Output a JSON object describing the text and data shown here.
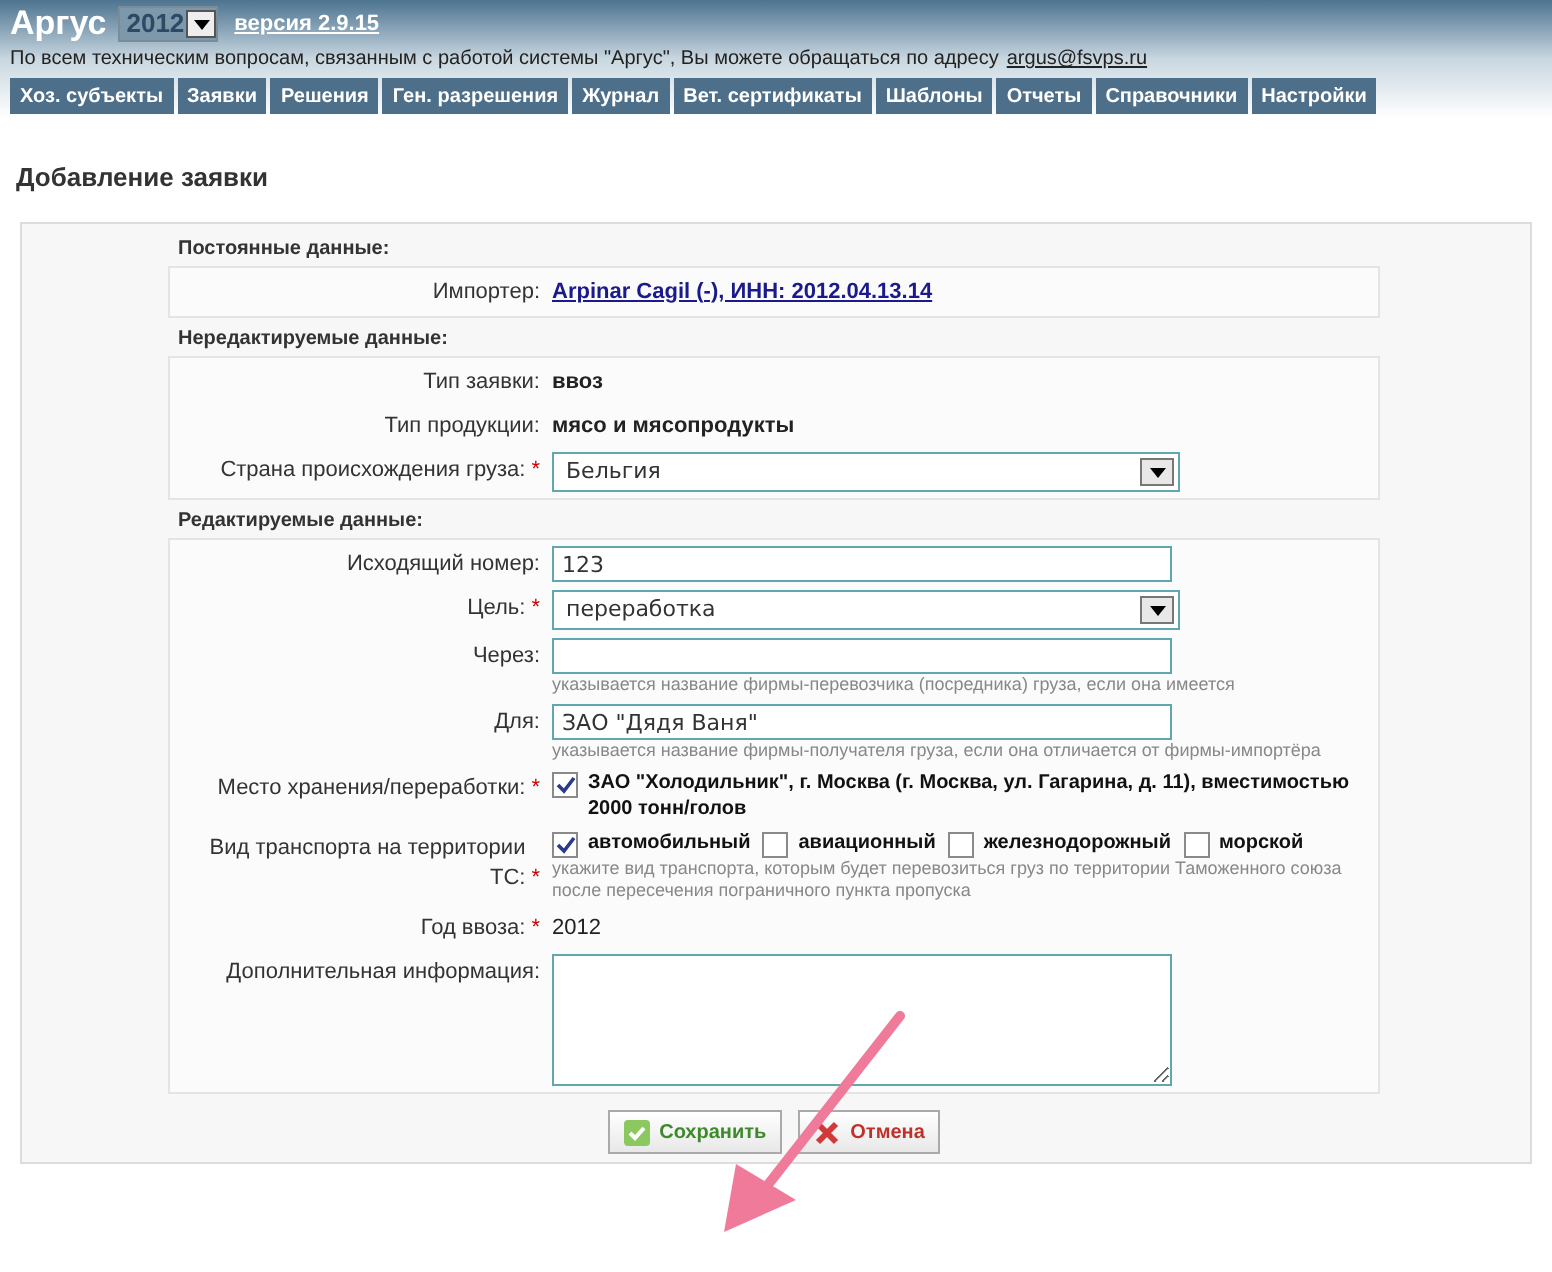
{
  "header": {
    "title": "Аргус",
    "year_select": {
      "value": "2012"
    },
    "version_link": "версия 2.9.15",
    "support_text": "По всем техническим вопросам, связанным с работой системы \"Аргус\", Вы можете обращаться по адресу",
    "support_email": "argus@fsvps.ru"
  },
  "menu": [
    {
      "label": "Хоз. субъекты"
    },
    {
      "label": "Заявки"
    },
    {
      "label": "Решения"
    },
    {
      "label": "Ген. разрешения"
    },
    {
      "label": "Журнал"
    },
    {
      "label": "Вет. сертификаты"
    },
    {
      "label": "Шаблоны"
    },
    {
      "label": "Отчеты"
    },
    {
      "label": "Справочники"
    },
    {
      "label": "Настройки"
    }
  ],
  "page_title": "Добавление заявки",
  "sections": [
    {
      "title": "Постоянные данные:",
      "rows": [
        {
          "kind": "link",
          "label": "Импортер:",
          "value": "Arpinar Cagil (-), ИНН: 2012.04.13.14"
        }
      ]
    },
    {
      "title": "Нередактируемые данные:",
      "rows": [
        {
          "kind": "text",
          "label": "Тип заявки:",
          "value": "ввоз"
        },
        {
          "kind": "text",
          "label": "Тип продукции:",
          "value": "мясо и мясопродукты"
        },
        {
          "kind": "select",
          "label": "Страна происхождения груза:",
          "required_mark": "*",
          "value": "Бельгия"
        }
      ]
    },
    {
      "title": "Редактируемые данные:",
      "rows": [
        {
          "kind": "input",
          "label": "Исходящий номер:",
          "value": "123"
        },
        {
          "kind": "select",
          "label": "Цель:",
          "required_mark": "*",
          "value": "переработка"
        },
        {
          "kind": "input",
          "label": "Через:",
          "hint": "указывается название фирмы-перевозчика (посредника) груза, если она имеется"
        },
        {
          "kind": "input",
          "label": "Для:",
          "value": "ЗАО \"Дядя Ваня\"",
          "hint": "указывается название фирмы-получателя груза, если она отличается от фирмы-импортёра"
        },
        {
          "kind": "checks",
          "label": "Место хранения/переработки:",
          "required_mark": "*",
          "items": [
            {
              "label": "ЗАО \"Холодильник\", г. Москва (г. Москва, ул. Гагарина, д. 11), вместимостью 2000 тонн/голов",
              "checked": true
            }
          ]
        },
        {
          "kind": "checks",
          "label": "Вид транспорта на территории ТС:",
          "required_mark": "*",
          "items": [
            {
              "label": "автомобильный",
              "checked": true
            },
            {
              "label": "авиационный",
              "checked": false
            },
            {
              "label": "железнодорожный",
              "checked": false
            },
            {
              "label": "морской",
              "checked": false
            }
          ],
          "hint": "укажите вид транспорта, которым будет перевозиться груз по территории Таможенного союза после пересечения пограничного пункта пропуска"
        },
        {
          "kind": "plain",
          "label": "Год ввоза:",
          "required_mark": "*",
          "value": "2012"
        },
        {
          "kind": "textarea",
          "label": "Дополнительная информация:"
        }
      ]
    }
  ],
  "buttons": [
    {
      "kind": "save",
      "label": "Сохранить"
    },
    {
      "kind": "cancel",
      "label": "Отмена"
    }
  ]
}
